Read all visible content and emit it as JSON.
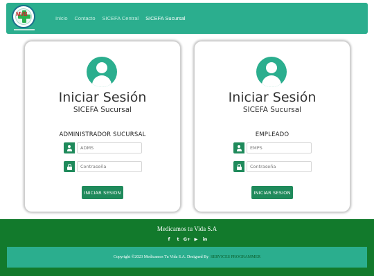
{
  "nav": {
    "logo_text": "MVB",
    "links": [
      "Inicio",
      "Contacto",
      "SICEFA Central",
      "SICEFA Sucursal"
    ],
    "active_index": 3
  },
  "cards": [
    {
      "title": "Iniciar Sesión",
      "subtitle": "SICEFA Sucursal",
      "role": "ADMINISTRADOR SUCURSAL",
      "user_placeholder": "ADMS",
      "password_placeholder": "Contraseña",
      "button_label": "INICIAR SESION"
    },
    {
      "title": "Iniciar Sesión",
      "subtitle": "SICEFA Sucursal",
      "role": "EMPLEADO",
      "user_placeholder": "EMPS",
      "password_placeholder": "Contraseña",
      "button_label": "INICIAR SESION"
    }
  ],
  "footer": {
    "title": "Medicamos tu Vida S.A",
    "socials": [
      {
        "icon": "facebook-icon",
        "glyph": "f"
      },
      {
        "icon": "twitter-icon",
        "glyph": "t"
      },
      {
        "icon": "google-plus-icon",
        "glyph": "G+"
      },
      {
        "icon": "youtube-icon",
        "glyph": "▶"
      },
      {
        "icon": "linkedin-icon",
        "glyph": "in"
      }
    ],
    "copyright_text": "Copyright ©2023 Medicamos Tu Vida S.A. Designed By",
    "designer_link": "SERVICES PROGRAMMER"
  },
  "colors": {
    "primary": "#2bae8e",
    "button": "#1f8a5b",
    "footer": "#127a2c"
  }
}
